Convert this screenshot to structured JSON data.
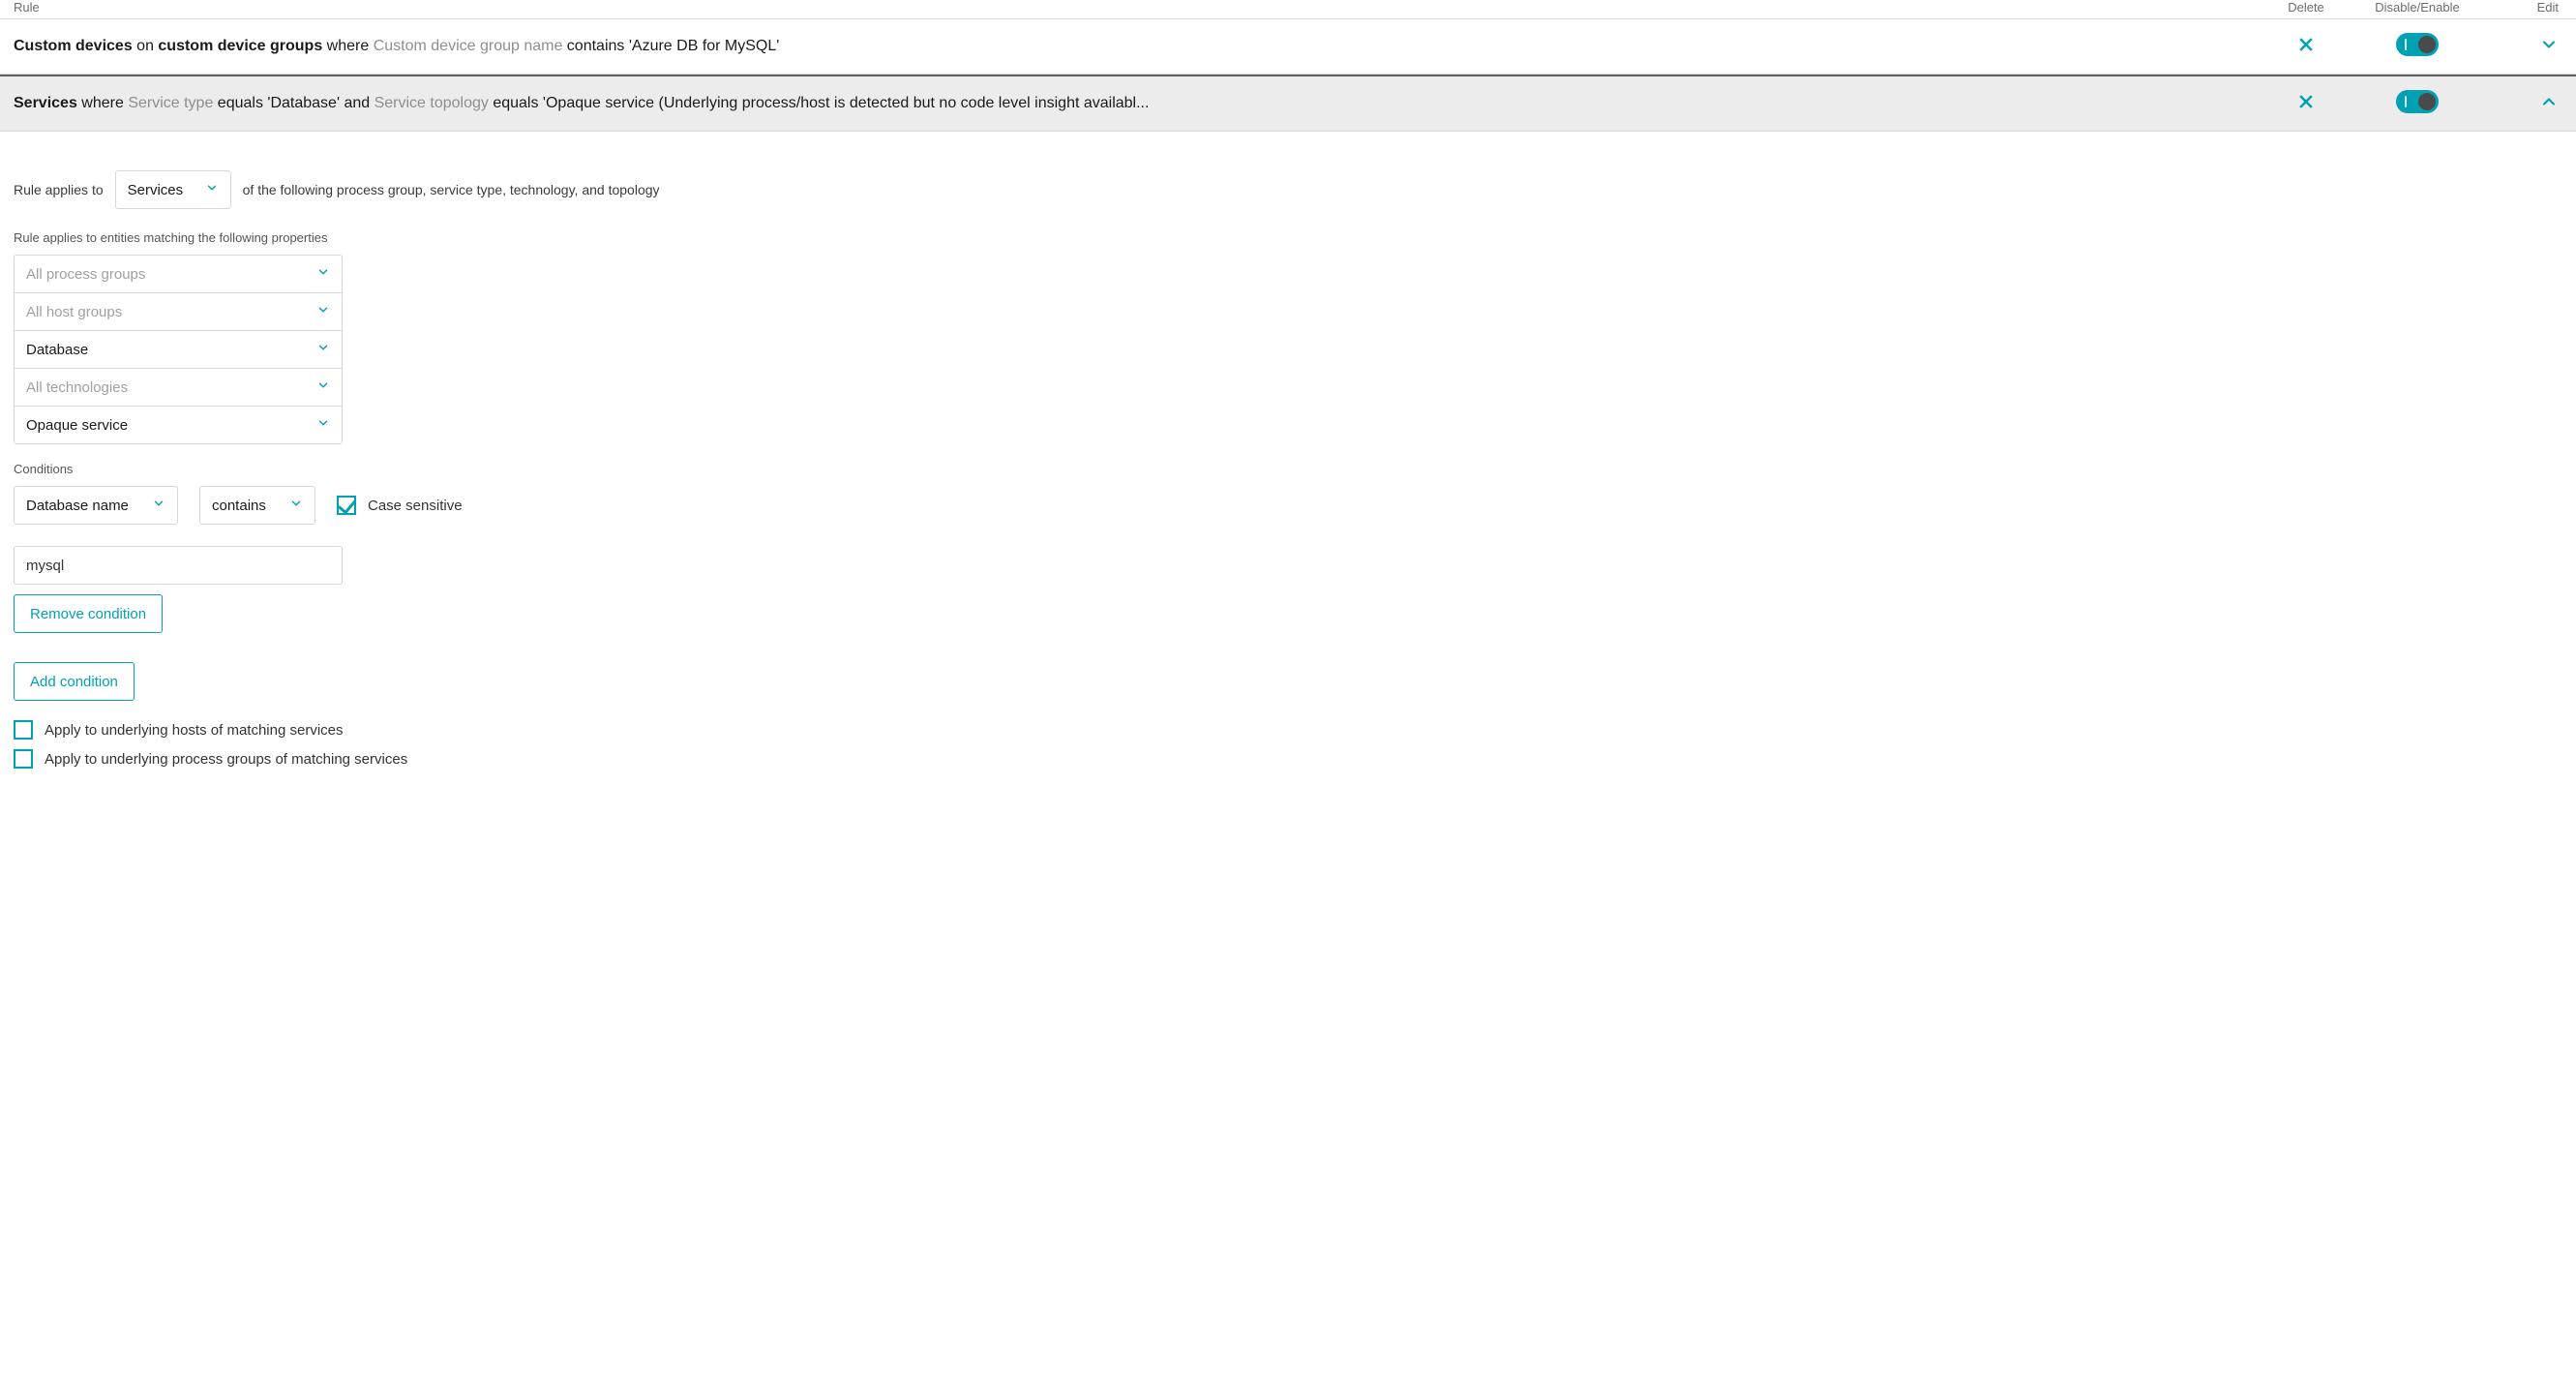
{
  "header": {
    "rule_label": "Rule",
    "delete_label": "Delete",
    "enable_label": "Disable/Enable",
    "edit_label": "Edit"
  },
  "rules": [
    {
      "parts": [
        {
          "t": "Custom devices",
          "s": "bold"
        },
        {
          "t": " on ",
          "s": ""
        },
        {
          "t": "custom device groups",
          "s": "bold"
        },
        {
          "t": " where ",
          "s": ""
        },
        {
          "t": "Custom device group name",
          "s": "grey"
        },
        {
          "t": " contains 'Azure DB for MySQL'",
          "s": ""
        }
      ],
      "enabled": true,
      "expanded": false
    },
    {
      "parts": [
        {
          "t": "Services",
          "s": "bold"
        },
        {
          "t": " where ",
          "s": ""
        },
        {
          "t": "Service type",
          "s": "grey"
        },
        {
          "t": " equals 'Database' and ",
          "s": ""
        },
        {
          "t": "Service topology",
          "s": "grey"
        },
        {
          "t": " equals 'Opaque service (Underlying process/host is detected but no code level insight availabl...",
          "s": ""
        }
      ],
      "enabled": true,
      "expanded": true
    }
  ],
  "editor": {
    "applies_intro": "Rule applies to",
    "applies_select": "Services",
    "applies_suffix": "of the following process group, service type, technology, and topology",
    "props_label": "Rule applies to entities matching the following properties",
    "filters": {
      "process_group": {
        "value": "",
        "placeholder": "All process groups"
      },
      "host_group": {
        "value": "",
        "placeholder": "All host groups"
      },
      "service_type": {
        "value": "Database",
        "placeholder": ""
      },
      "technology": {
        "value": "",
        "placeholder": "All technologies"
      },
      "topology": {
        "value": "Opaque service",
        "placeholder": ""
      }
    },
    "conditions_label": "Conditions",
    "condition": {
      "attribute": "Database name",
      "operator": "contains",
      "case_sensitive_label": "Case sensitive",
      "case_sensitive_checked": true,
      "value": "mysql"
    },
    "remove_condition_label": "Remove condition",
    "add_condition_label": "Add condition",
    "apply_hosts_label": "Apply to underlying hosts of matching services",
    "apply_hosts_checked": false,
    "apply_pgs_label": "Apply to underlying process groups of matching services",
    "apply_pgs_checked": false
  }
}
